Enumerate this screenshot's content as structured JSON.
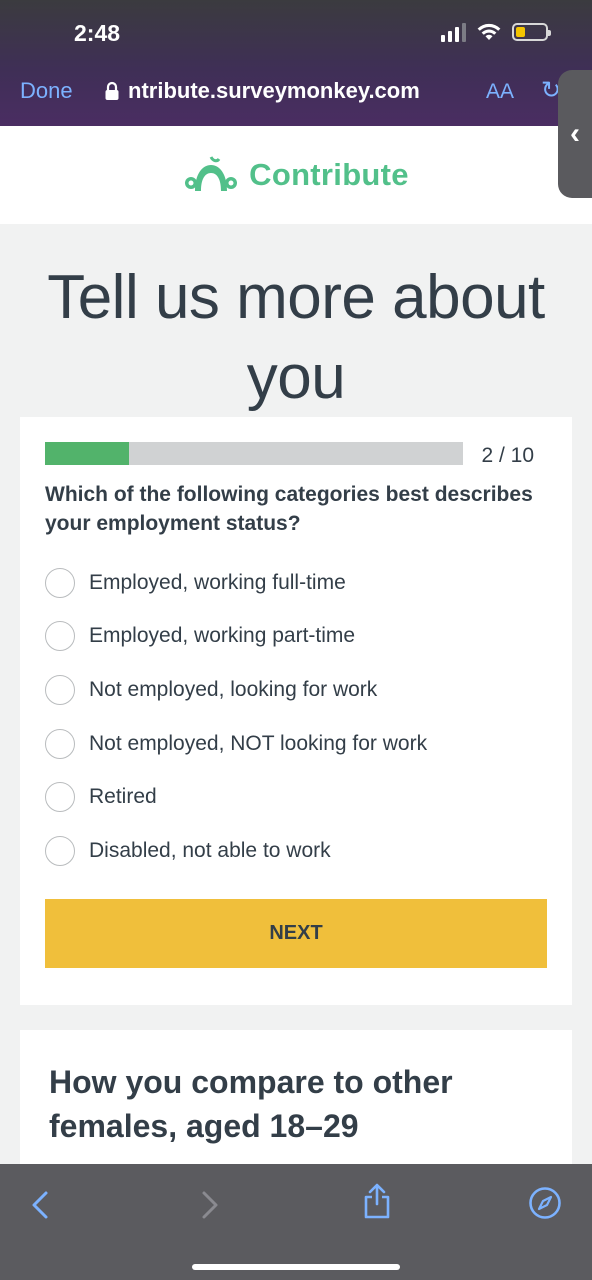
{
  "status_bar": {
    "time": "2:48"
  },
  "browser": {
    "done_label": "Done",
    "url": "ntribute.surveymonkey.com",
    "aa_label": "AA"
  },
  "logo": {
    "text": "Contribute"
  },
  "hero": {
    "title": "Tell us more about you"
  },
  "survey": {
    "progress": {
      "current": 2,
      "total": 10,
      "fraction": 0.2,
      "label": "2 / 10"
    },
    "question": "Which of the following categories best describes your employment status?",
    "options": [
      "Employed, working full-time",
      "Employed, working part-time",
      "Not employed, looking for work",
      "Not employed, NOT looking for work",
      "Retired",
      "Disabled, not able to work"
    ],
    "next_label": "NEXT"
  },
  "compare": {
    "title": "How you compare to other females, aged 18–29"
  },
  "colors": {
    "brand_green": "#52c08a",
    "progress_green": "#52b36b",
    "next_button": "#f0bf3b",
    "text_dark": "#333e48",
    "ios_link_blue": "#7cb2ff"
  }
}
